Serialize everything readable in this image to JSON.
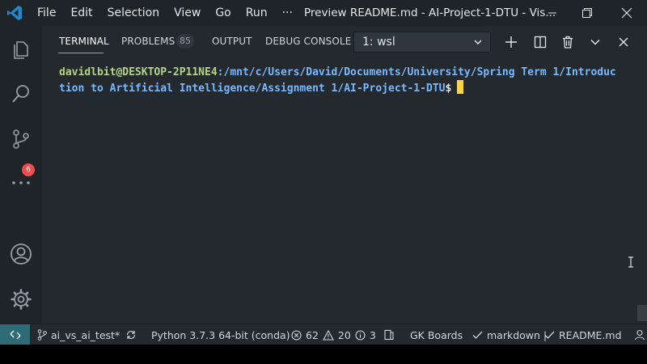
{
  "menu": [
    "File",
    "Edit",
    "Selection",
    "View",
    "Go",
    "Run",
    "···"
  ],
  "window_title": "Preview README.md - AI-Project-1-DTU - Vis...",
  "activity": {
    "scm_badge": "6"
  },
  "panel": {
    "tabs": {
      "terminal": "TERMINAL",
      "problems": "PROBLEMS",
      "problems_count": "85",
      "output": "OUTPUT",
      "debug_console": "DEBUG CONSOLE"
    },
    "terminal_select": "1: wsl"
  },
  "terminal": {
    "user_host": "davidlbit@DESKTOP-2P11NE4",
    "path_line1": ":/mnt/c/Users/David/Documents/University/Spring Term 1/Introduc",
    "path_line2": "tion to Artificial Intelligence/Assignment 1/AI-Project-1-DTU",
    "prompt": "$"
  },
  "statusbar": {
    "branch": "ai_vs_ai_test*",
    "python": "Python 3.7.3 64-bit (conda)",
    "errors": "62",
    "warnings": "20",
    "info": "3",
    "gk_boards": "GK Boards",
    "markdown": "markdown |",
    "readme": "README.md"
  },
  "colors": {
    "accent_tab": "#f9826c",
    "terminal_user": "#b5d48a",
    "terminal_path": "#79b8ff",
    "cursor": "#ffd33d",
    "badge": "#f14c4c",
    "remote": "#2d6b76"
  }
}
